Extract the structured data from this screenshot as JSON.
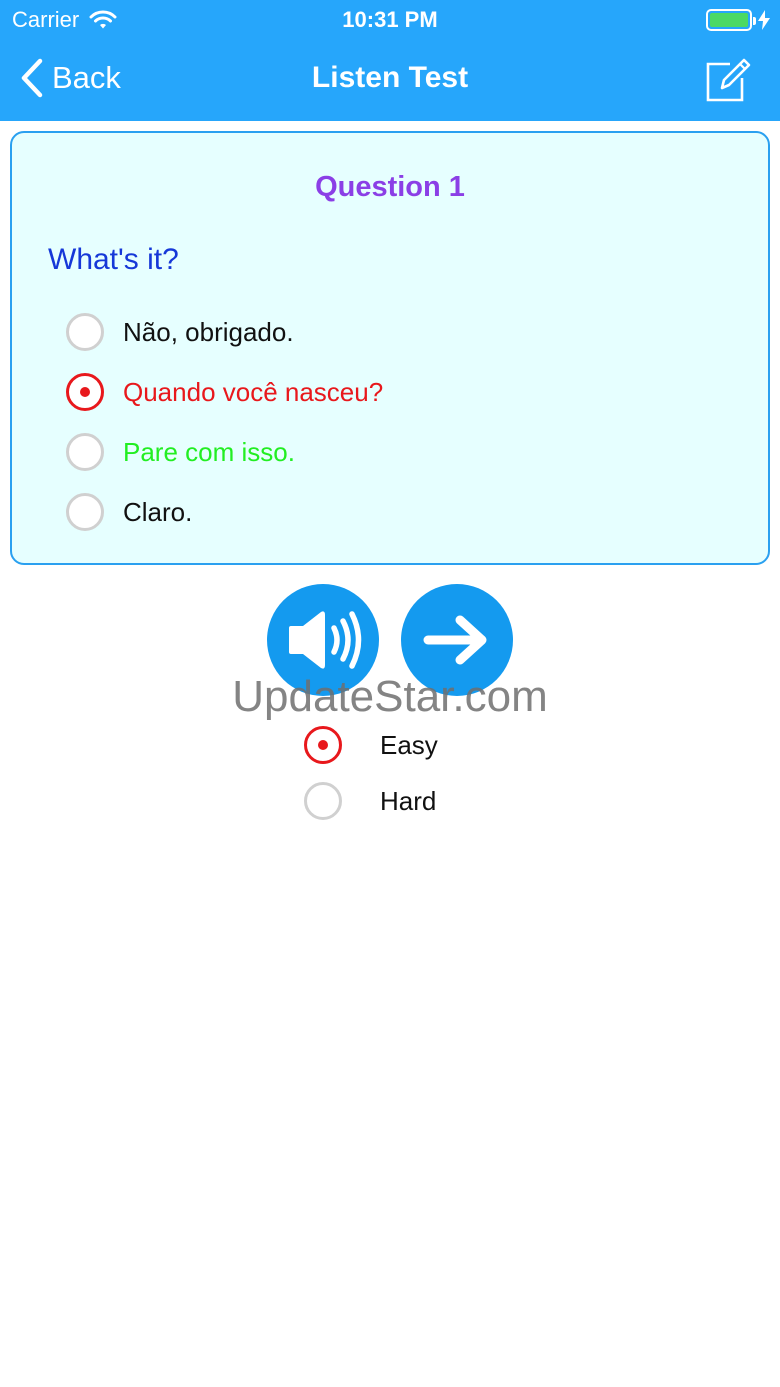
{
  "status_bar": {
    "carrier": "Carrier",
    "time": "10:31 PM",
    "battery_color": "#4cd964"
  },
  "nav": {
    "back_label": "Back",
    "title": "Listen Test",
    "bar_color": "#26a6fb"
  },
  "question": {
    "title": "Question 1",
    "prompt": "What's it?",
    "options": [
      {
        "text": "Não, obrigado.",
        "color": "#111111",
        "selected": false
      },
      {
        "text": "Quando você nasceu?",
        "color": "#e8181c",
        "selected": true
      },
      {
        "text": "Pare com isso.",
        "color": "#22ee22",
        "selected": false
      },
      {
        "text": "Claro.",
        "color": "#111111",
        "selected": false
      }
    ]
  },
  "controls": {
    "speaker_icon": "speaker-icon",
    "next_icon": "arrow-right-icon"
  },
  "watermark": "UpdateStar.com",
  "difficulty": {
    "options": [
      {
        "label": "Easy",
        "selected": true
      },
      {
        "label": "Hard",
        "selected": false
      }
    ]
  }
}
